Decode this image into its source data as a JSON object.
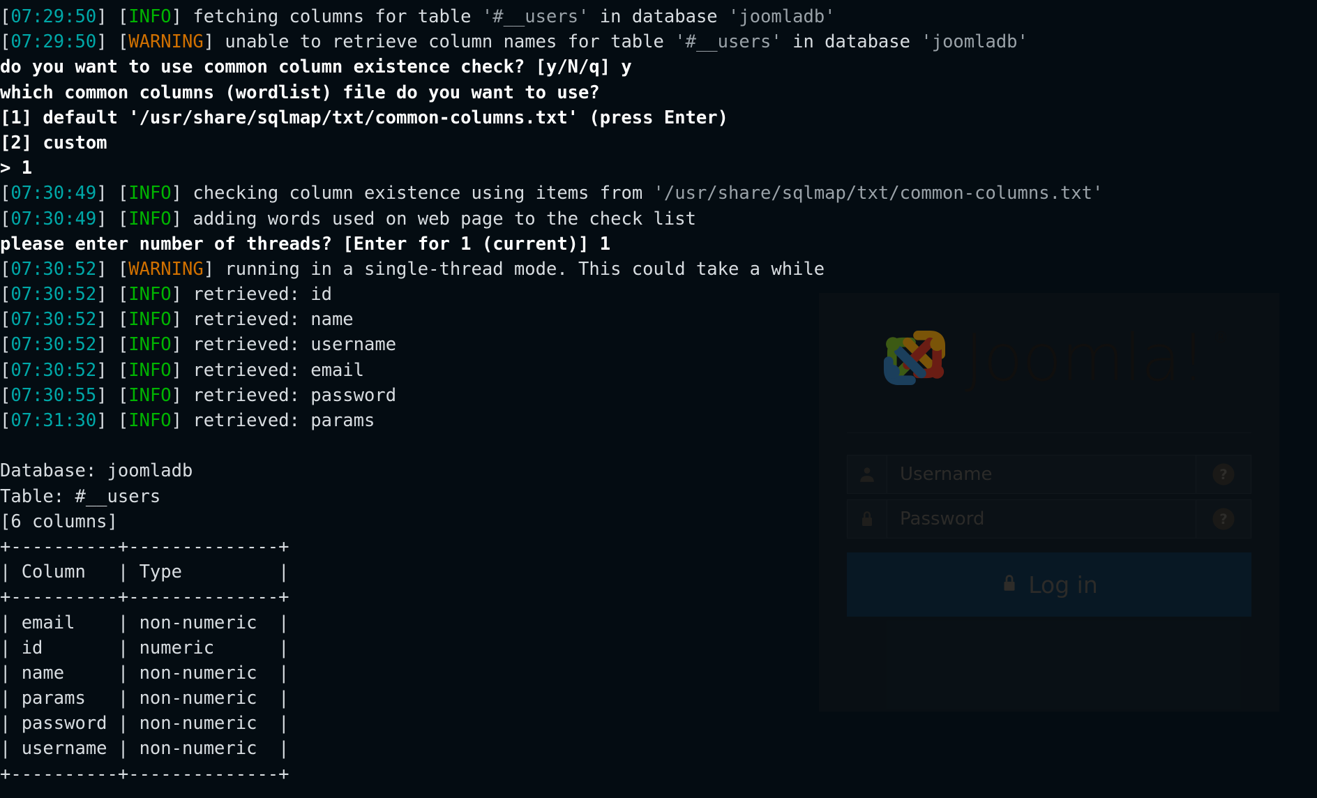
{
  "terminal": {
    "background_color": "#040c12",
    "text_color": "#d8dde1",
    "timestamp_color": "#00a8a8",
    "info_color": "#00b400",
    "warning_color": "#d07000",
    "lines": [
      {
        "id": "log-fetching-columns",
        "segs": [
          {
            "t": "[",
            "c": "plain"
          },
          {
            "t": "07:29:50",
            "c": "time"
          },
          {
            "t": "] [",
            "c": "plain"
          },
          {
            "t": "INFO",
            "c": "info"
          },
          {
            "t": "] fetching columns for table ",
            "c": "plain"
          },
          {
            "t": "'#__users'",
            "c": "dim"
          },
          {
            "t": " in database ",
            "c": "plain"
          },
          {
            "t": "'joomladb'",
            "c": "dim"
          }
        ]
      },
      {
        "id": "log-unable-retrieve",
        "segs": [
          {
            "t": "[",
            "c": "plain"
          },
          {
            "t": "07:29:50",
            "c": "time"
          },
          {
            "t": "] [",
            "c": "plain"
          },
          {
            "t": "WARNING",
            "c": "warn"
          },
          {
            "t": "] unable to retrieve column names for table ",
            "c": "plain"
          },
          {
            "t": "'#__users'",
            "c": "dim"
          },
          {
            "t": " in database ",
            "c": "plain"
          },
          {
            "t": "'joomladb'",
            "c": "dim"
          }
        ]
      },
      {
        "id": "prompt-common-column-check",
        "segs": [
          {
            "t": "do you want to use common column existence check? [y/N/q] y",
            "c": "bold"
          }
        ]
      },
      {
        "id": "prompt-which-wordlist",
        "segs": [
          {
            "t": "which common columns (wordlist) file do you want to use?",
            "c": "bold"
          }
        ]
      },
      {
        "id": "option-1-default",
        "segs": [
          {
            "t": "[1] default '/usr/share/sqlmap/txt/common-columns.txt' (press Enter)",
            "c": "bold"
          }
        ]
      },
      {
        "id": "option-2-custom",
        "segs": [
          {
            "t": "[2] custom",
            "c": "bold"
          }
        ]
      },
      {
        "id": "user-answer-wordlist",
        "segs": [
          {
            "t": "> 1",
            "c": "bold"
          }
        ]
      },
      {
        "id": "log-checking-existence",
        "segs": [
          {
            "t": "[",
            "c": "plain"
          },
          {
            "t": "07:30:49",
            "c": "time"
          },
          {
            "t": "] [",
            "c": "plain"
          },
          {
            "t": "INFO",
            "c": "info"
          },
          {
            "t": "] checking column existence using items from ",
            "c": "plain"
          },
          {
            "t": "'/usr/share/sqlmap/txt/common-columns.txt'",
            "c": "dim"
          }
        ]
      },
      {
        "id": "log-adding-words",
        "segs": [
          {
            "t": "[",
            "c": "plain"
          },
          {
            "t": "07:30:49",
            "c": "time"
          },
          {
            "t": "] [",
            "c": "plain"
          },
          {
            "t": "INFO",
            "c": "info"
          },
          {
            "t": "] adding words used on web page to the check list",
            "c": "plain"
          }
        ]
      },
      {
        "id": "prompt-threads",
        "segs": [
          {
            "t": "please enter number of threads? [Enter for 1 (current)] 1",
            "c": "bold"
          }
        ]
      },
      {
        "id": "log-single-thread-warning",
        "segs": [
          {
            "t": "[",
            "c": "plain"
          },
          {
            "t": "07:30:52",
            "c": "time"
          },
          {
            "t": "] [",
            "c": "plain"
          },
          {
            "t": "WARNING",
            "c": "warn"
          },
          {
            "t": "] running in a single-thread mode. This could take a while",
            "c": "plain"
          }
        ]
      },
      {
        "id": "log-retrieved-id",
        "segs": [
          {
            "t": "[",
            "c": "plain"
          },
          {
            "t": "07:30:52",
            "c": "time"
          },
          {
            "t": "] [",
            "c": "plain"
          },
          {
            "t": "INFO",
            "c": "info"
          },
          {
            "t": "] retrieved: id",
            "c": "plain"
          }
        ]
      },
      {
        "id": "log-retrieved-name",
        "segs": [
          {
            "t": "[",
            "c": "plain"
          },
          {
            "t": "07:30:52",
            "c": "time"
          },
          {
            "t": "] [",
            "c": "plain"
          },
          {
            "t": "INFO",
            "c": "info"
          },
          {
            "t": "] retrieved: name",
            "c": "plain"
          }
        ]
      },
      {
        "id": "log-retrieved-username",
        "segs": [
          {
            "t": "[",
            "c": "plain"
          },
          {
            "t": "07:30:52",
            "c": "time"
          },
          {
            "t": "] [",
            "c": "plain"
          },
          {
            "t": "INFO",
            "c": "info"
          },
          {
            "t": "] retrieved: username",
            "c": "plain"
          }
        ]
      },
      {
        "id": "log-retrieved-email",
        "segs": [
          {
            "t": "[",
            "c": "plain"
          },
          {
            "t": "07:30:52",
            "c": "time"
          },
          {
            "t": "] [",
            "c": "plain"
          },
          {
            "t": "INFO",
            "c": "info"
          },
          {
            "t": "] retrieved: email",
            "c": "plain"
          }
        ]
      },
      {
        "id": "log-retrieved-password",
        "segs": [
          {
            "t": "[",
            "c": "plain"
          },
          {
            "t": "07:30:55",
            "c": "time"
          },
          {
            "t": "] [",
            "c": "plain"
          },
          {
            "t": "INFO",
            "c": "info"
          },
          {
            "t": "] retrieved: password",
            "c": "plain"
          }
        ]
      },
      {
        "id": "log-retrieved-params",
        "segs": [
          {
            "t": "[",
            "c": "plain"
          },
          {
            "t": "07:31:30",
            "c": "time"
          },
          {
            "t": "] [",
            "c": "plain"
          },
          {
            "t": "INFO",
            "c": "info"
          },
          {
            "t": "] retrieved: params",
            "c": "plain"
          }
        ]
      },
      {
        "id": "blank-1",
        "segs": [
          {
            "t": " ",
            "c": "plain"
          }
        ]
      },
      {
        "id": "result-database",
        "segs": [
          {
            "t": "Database: joomladb",
            "c": "plain"
          }
        ]
      },
      {
        "id": "result-table",
        "segs": [
          {
            "t": "Table: #__users",
            "c": "plain"
          }
        ]
      },
      {
        "id": "result-column-count",
        "segs": [
          {
            "t": "[6 columns]",
            "c": "plain"
          }
        ]
      },
      {
        "id": "table-rule-top",
        "segs": [
          {
            "t": "+----------+--------------+",
            "c": "plain"
          }
        ]
      },
      {
        "id": "table-header",
        "segs": [
          {
            "t": "| Column   | Type         |",
            "c": "plain"
          }
        ]
      },
      {
        "id": "table-rule-mid",
        "segs": [
          {
            "t": "+----------+--------------+",
            "c": "plain"
          }
        ]
      },
      {
        "id": "table-row-email",
        "segs": [
          {
            "t": "| email    | non-numeric  |",
            "c": "plain"
          }
        ]
      },
      {
        "id": "table-row-id",
        "segs": [
          {
            "t": "| id       | numeric      |",
            "c": "plain"
          }
        ]
      },
      {
        "id": "table-row-name",
        "segs": [
          {
            "t": "| name     | non-numeric  |",
            "c": "plain"
          }
        ]
      },
      {
        "id": "table-row-params",
        "segs": [
          {
            "t": "| params   | non-numeric  |",
            "c": "plain"
          }
        ]
      },
      {
        "id": "table-row-password",
        "segs": [
          {
            "t": "| password | non-numeric  |",
            "c": "plain"
          }
        ]
      },
      {
        "id": "table-row-username",
        "segs": [
          {
            "t": "| username | non-numeric  |",
            "c": "plain"
          }
        ]
      },
      {
        "id": "table-rule-bottom",
        "segs": [
          {
            "t": "+----------+--------------+",
            "c": "plain"
          }
        ]
      }
    ],
    "result_table": {
      "database": "joomladb",
      "table": "#__users",
      "column_count_label": "[6 columns]",
      "headers": [
        "Column",
        "Type"
      ],
      "rows": [
        [
          "email",
          "non-numeric"
        ],
        [
          "id",
          "numeric"
        ],
        [
          "name",
          "non-numeric"
        ],
        [
          "params",
          "non-numeric"
        ],
        [
          "password",
          "non-numeric"
        ],
        [
          "username",
          "non-numeric"
        ]
      ]
    }
  },
  "joomla_login": {
    "logo_alt": "Joomla!",
    "wordmark": "Joomla!",
    "registered_mark": "®",
    "logo_colors": {
      "green": "#3c5a14",
      "orange": "#7a5408",
      "red": "#6a1d14",
      "blue": "#1b3f5c"
    },
    "username": {
      "icon": "user-icon",
      "placeholder": "Username",
      "value": "",
      "help_icon": "question-circle-icon"
    },
    "password": {
      "icon": "lock-icon",
      "placeholder": "Password",
      "value": "",
      "help_icon": "question-circle-icon"
    },
    "login_button": {
      "label": "Log in",
      "icon": "lock-icon",
      "background_color": "#081e2e"
    }
  }
}
